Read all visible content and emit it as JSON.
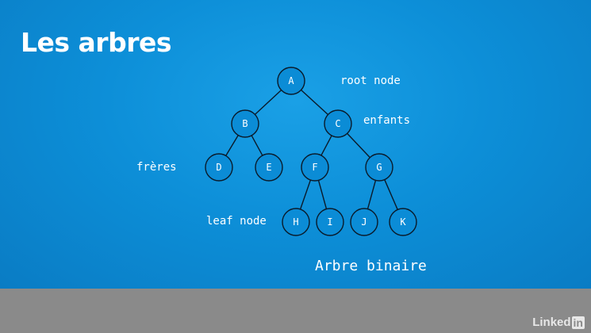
{
  "slide": {
    "title": "Les arbres",
    "caption": "Arbre binaire",
    "annotations": {
      "root": "root node",
      "children": "enfants",
      "siblings": "frères",
      "leaf": "leaf node"
    }
  },
  "tree": {
    "nodes": [
      "A",
      "B",
      "C",
      "D",
      "E",
      "F",
      "G",
      "H",
      "I",
      "J",
      "K"
    ],
    "edges": [
      [
        "A",
        "B"
      ],
      [
        "A",
        "C"
      ],
      [
        "B",
        "D"
      ],
      [
        "B",
        "E"
      ],
      [
        "C",
        "F"
      ],
      [
        "C",
        "G"
      ],
      [
        "F",
        "H"
      ],
      [
        "F",
        "I"
      ],
      [
        "G",
        "J"
      ],
      [
        "G",
        "K"
      ]
    ]
  },
  "logo": {
    "word": "Linked",
    "box": "in"
  },
  "colors": {
    "slide_bg": "#0d8fd8",
    "node_stroke": "#0a1a2a",
    "text": "#ffffff",
    "bottom_bar": "#8a8a8a"
  }
}
